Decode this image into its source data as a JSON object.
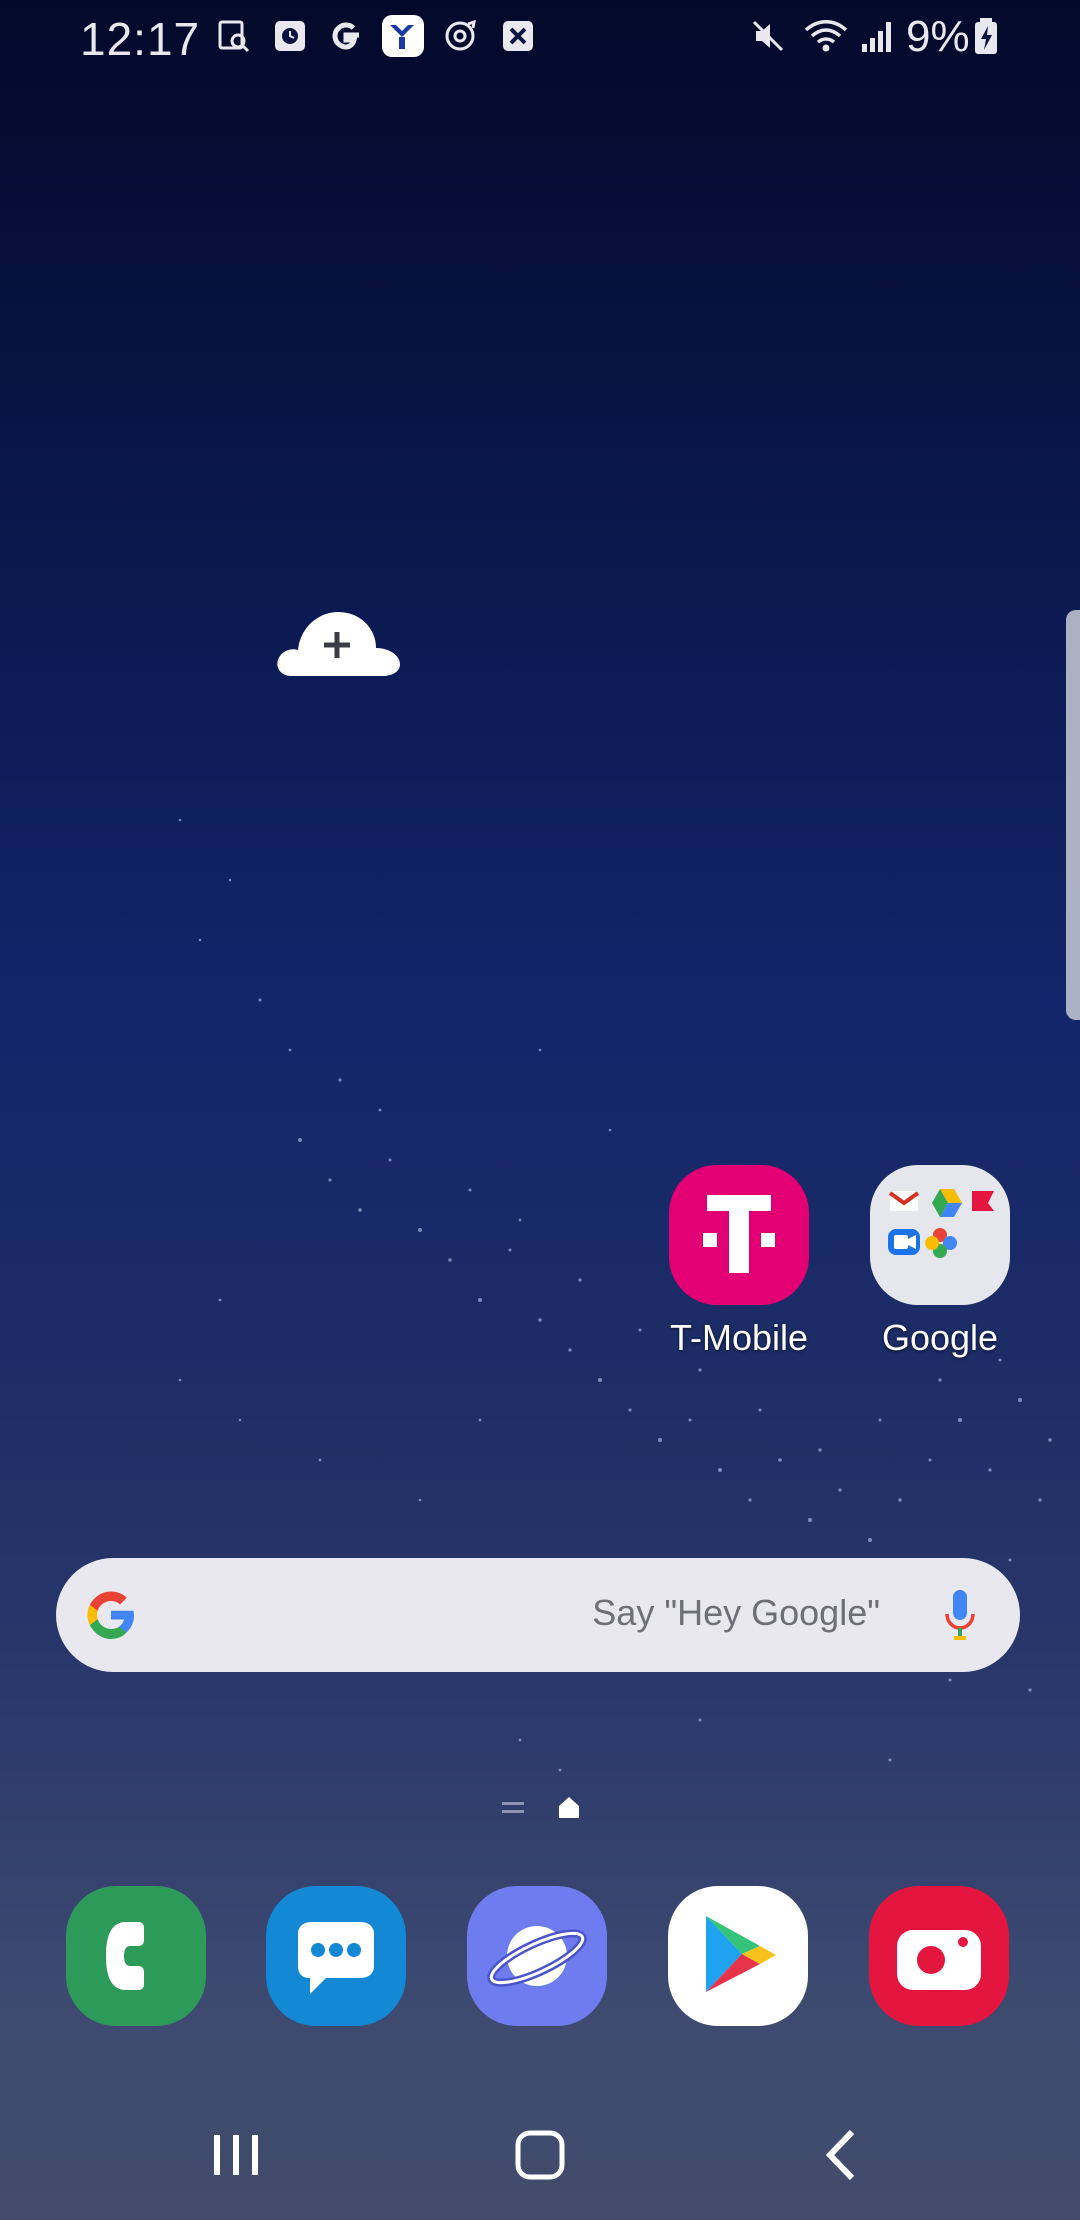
{
  "status_bar": {
    "time": "12:17",
    "notification_icons": [
      "screen-search-icon",
      "clock-icon",
      "google-icon",
      "ymca-icon",
      "sync-icon",
      "close-icon"
    ],
    "system_icons": [
      "mute-icon",
      "wifi-icon",
      "signal-icon",
      "battery-charging-icon"
    ],
    "battery_percent": "9%"
  },
  "home": {
    "cloud_icon": "cloud-plus-icon",
    "apps": [
      {
        "label": "T-Mobile",
        "icon": "tmobile-icon"
      },
      {
        "label": "Google",
        "icon": "google-folder-icon"
      }
    ]
  },
  "search": {
    "hint": "Say \"Hey Google\"",
    "logo": "google-g-icon",
    "mic": "mic-icon"
  },
  "dock": [
    {
      "name": "Phone",
      "icon": "phone-icon",
      "color": "#2e9a5a"
    },
    {
      "name": "Messages",
      "icon": "messages-icon",
      "color": "#1389d6"
    },
    {
      "name": "Internet",
      "icon": "internet-icon",
      "color": "#6f7cf0"
    },
    {
      "name": "Play Store",
      "icon": "play-store-icon",
      "color": "#ffffff"
    },
    {
      "name": "Camera",
      "icon": "camera-icon",
      "color": "#e4163f"
    }
  ],
  "navigation": {
    "recents": "recents-icon",
    "home": "home-icon",
    "back": "back-icon"
  }
}
